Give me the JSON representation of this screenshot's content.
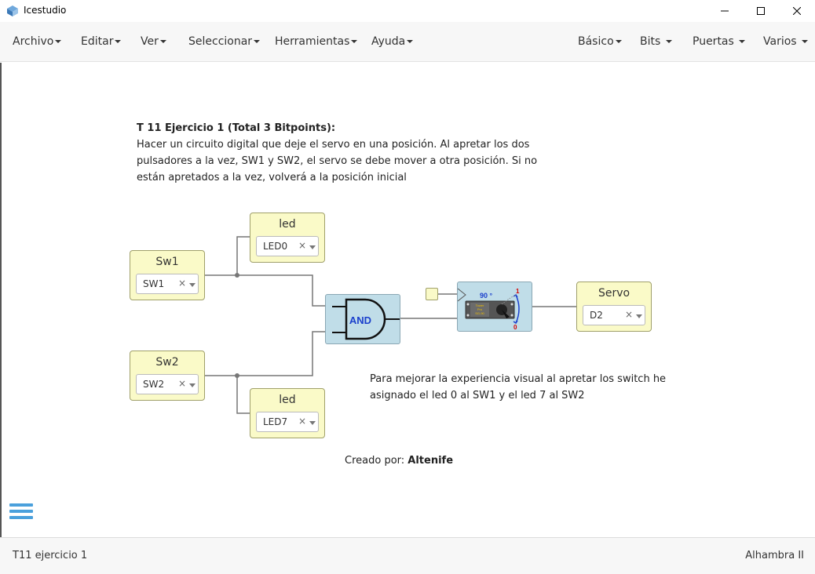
{
  "window": {
    "title": "Icestudio",
    "icon": "icestudio-logo-icon"
  },
  "menu": {
    "left": [
      {
        "label": "Archivo"
      },
      {
        "label": "Editar"
      },
      {
        "label": "Ver"
      },
      {
        "label": "Seleccionar"
      },
      {
        "label": "Herramientas"
      },
      {
        "label": "Ayuda"
      }
    ],
    "right": [
      {
        "label": "Básico"
      },
      {
        "label": "Bits"
      },
      {
        "label": "Puertas"
      },
      {
        "label": "Varios"
      }
    ]
  },
  "canvas": {
    "info": {
      "title": "T 11 Ejercicio 1 (Total 3 Bitpoints):",
      "lines": [
        "Hacer un circuito digital que deje el servo en una posición. Al apretar los dos",
        "pulsadores a la vez, SW1 y SW2, el servo se debe mover a otra posición. Si no",
        "están apretados a la vez, volverá a la posición inicial"
      ]
    },
    "note": {
      "lines": [
        "Para mejorar la experiencia visual al apretar los switch he",
        "asignado el led 0 al SW1 y el led 7 al SW2"
      ]
    },
    "credit": {
      "prefix": "Creado por: ",
      "author": "Altenife"
    },
    "blocks": {
      "sw1": {
        "label": "Sw1",
        "value": "SW1",
        "clear": "×"
      },
      "sw2": {
        "label": "Sw2",
        "value": "SW2",
        "clear": "×"
      },
      "led0": {
        "label": "led",
        "value": "LED0",
        "clear": "×"
      },
      "led7": {
        "label": "led",
        "value": "LED7",
        "clear": "×"
      },
      "servo_out": {
        "label": "Servo",
        "value": "D2",
        "clear": "×"
      },
      "and_gate": {
        "label": "AND"
      },
      "servo_block": {
        "angle": "90 °",
        "pos_high": "1",
        "pos_low": "0",
        "brand_line1": "Tower",
        "brand_line2": "Pro",
        "brand_line3": "SG-90"
      }
    }
  },
  "footer": {
    "file": "T11 ejercicio 1",
    "board": "Alhambra II"
  },
  "colors": {
    "io_block": "#fafac8",
    "logic_block": "#c0dde8",
    "wire": "#777777",
    "hamburger": "#4aa0dc"
  }
}
